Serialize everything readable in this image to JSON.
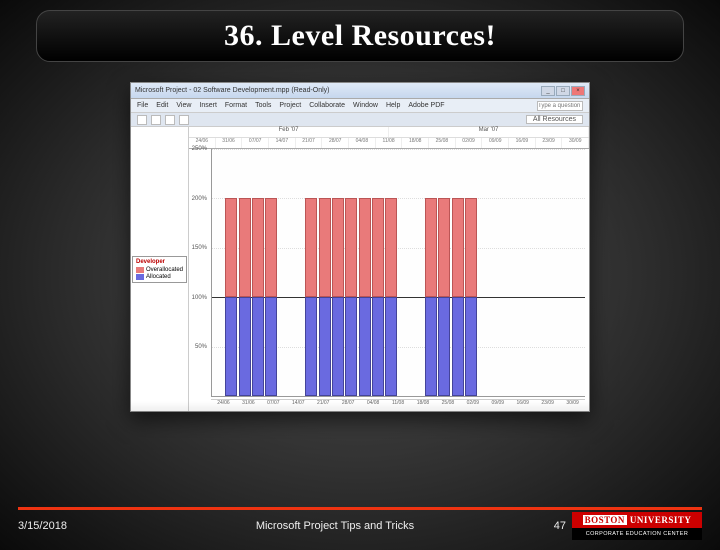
{
  "slide": {
    "title": "36. Level Resources!",
    "date": "3/15/2018",
    "footer_text": "Microsoft Project Tips and Tricks",
    "page_number": "47"
  },
  "logo": {
    "top_left": "BOSTON",
    "top_right": "UNIVERSITY",
    "bottom": "CORPORATE EDUCATION CENTER"
  },
  "mp_window": {
    "title": "Microsoft Project - 02 Software Development.mpp (Read-Only)",
    "menu": [
      "File",
      "Edit",
      "View",
      "Insert",
      "Format",
      "Tools",
      "Project",
      "Collaborate",
      "Window",
      "Help",
      "Adobe PDF"
    ],
    "search_placeholder": "Type a question for help",
    "toolbar_label": "All Resources"
  },
  "legend": {
    "title": "Developer",
    "rows": [
      {
        "label": "Overallocated",
        "color": "red"
      },
      {
        "label": "Allocated",
        "color": "blue"
      }
    ]
  },
  "chart_data": {
    "type": "bar",
    "title": "",
    "xlabel": "",
    "ylabel": "",
    "ylim": [
      0,
      250
    ],
    "y_ticks": [
      "250%",
      "200%",
      "150%",
      "100%",
      "50%"
    ],
    "header_months": [
      "Feb '07",
      "Mar '07"
    ],
    "x_ticks": [
      "24/06",
      "31/06",
      "07/07",
      "14/07",
      "21/07",
      "28/07",
      "04/08",
      "11/08",
      "18/08",
      "25/08",
      "02/09",
      "09/09",
      "16/09",
      "23/09",
      "30/09"
    ],
    "series": [
      {
        "name": "Overallocated",
        "color": "#e97a7a"
      },
      {
        "name": "Allocated",
        "color": "#6a6ae0"
      }
    ],
    "categories_idx": [
      0,
      1,
      2,
      3,
      4,
      5,
      6,
      7,
      8,
      9,
      10,
      11,
      12,
      13,
      14,
      15,
      16,
      17,
      18,
      19,
      20,
      21,
      22,
      23,
      24,
      25,
      26,
      27
    ],
    "allocated": [
      0,
      100,
      100,
      100,
      100,
      0,
      0,
      100,
      100,
      100,
      100,
      100,
      100,
      100,
      0,
      0,
      100,
      100,
      100,
      100,
      0,
      0,
      0,
      0,
      0,
      0,
      0,
      0
    ],
    "overallocated": [
      0,
      100,
      100,
      100,
      100,
      0,
      0,
      100,
      100,
      100,
      100,
      100,
      100,
      100,
      0,
      0,
      100,
      100,
      100,
      100,
      0,
      0,
      0,
      0,
      0,
      0,
      0,
      0
    ]
  }
}
